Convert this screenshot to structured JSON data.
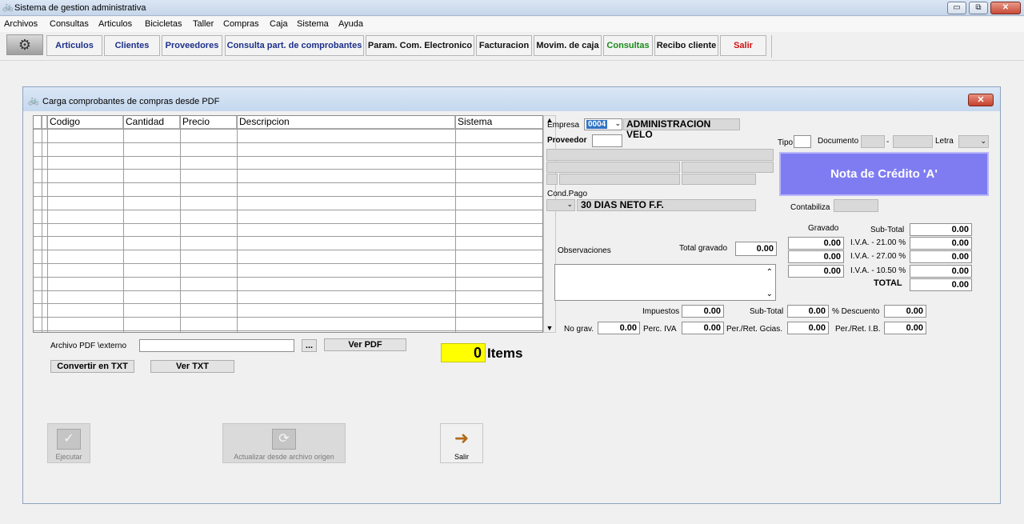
{
  "window": {
    "title": "Sistema de gestion administrativa",
    "min_btn": "▭",
    "max_btn": "⧉",
    "close_btn": "✕"
  },
  "menu": [
    "Archivos",
    "Consultas",
    "Articulos",
    "Bicicletas",
    "Taller",
    "Compras",
    "Caja",
    "Sistema",
    "Ayuda"
  ],
  "toolbar": {
    "logo_icon": "bicycle-chain-logo",
    "buttons": [
      "Articulos",
      "Clientes",
      "Proveedores",
      "Consulta part. de comprobantes",
      "Param. Com. Electronico",
      "Facturacion",
      "Movim. de caja",
      "Consultas",
      "Recibo cliente",
      "Salir"
    ]
  },
  "child": {
    "title": "Carga comprobantes de compras desde PDF",
    "close_btn": "✕",
    "grid": {
      "columns": [
        "Codigo",
        "Cantidad",
        "Precio",
        "Descripcion",
        "Sistema"
      ],
      "row_count": 15
    },
    "pdf_label": "Archivo PDF \\externo",
    "pdf_value": "",
    "browse_btn": "...",
    "ver_pdf_btn": "Ver PDF",
    "convertir_btn": "Convertir en TXT",
    "ver_txt_btn": "Ver TXT",
    "items_count": "0",
    "items_label": "Items",
    "ejecutar_btn": "Ejecutar",
    "actualizar_btn": "Actualizar desde archivo origen",
    "salir_btn": "Salir",
    "empresa_label": "Empresa",
    "empresa_code": "0004",
    "empresa_name": "ADMINISTRACION VELO",
    "proveedor_label": "Proveedor",
    "tipo_label": "Tipo",
    "documento_label": "Documento",
    "doc_sep": "-",
    "letra_label": "Letra",
    "doc_type": "Nota de Crédito 'A'",
    "cond_pago_label": "Cond.Pago",
    "cond_pago_value": "30 DIAS NETO F.F.",
    "contabiliza_label": "Contabiliza",
    "observaciones_label": "Observaciones",
    "total_gravado_label": "Total gravado",
    "total_gravado": "0.00",
    "gravado_label": "Gravado",
    "subtotal_label": "Sub-Total",
    "subtotal": "0.00",
    "gravado_rows": [
      {
        "gravado": "0.00",
        "label": "I.V.A. - 21.00 %",
        "value": "0.00"
      },
      {
        "gravado": "0.00",
        "label": "I.V.A. - 27.00 %",
        "value": "0.00"
      },
      {
        "gravado": "0.00",
        "label": "I.V.A. - 10.50 %",
        "value": "0.00"
      }
    ],
    "total_label": "TOTAL",
    "total": "0.00",
    "impuestos_label": "Impuestos",
    "impuestos": "0.00",
    "subtotal2_label": "Sub-Total",
    "subtotal2": "0.00",
    "descuento_label": "% Descuento",
    "descuento": "0.00",
    "no_grav_label": "No grav.",
    "no_grav": "0.00",
    "perc_iva_label": "Perc. IVA",
    "perc_iva": "0.00",
    "per_gcias_label": "Per./Ret. Gcias.",
    "per_gcias": "0.00",
    "per_ib_label": "Per./Ret. I.B.",
    "per_ib": "0.00"
  },
  "colors": {
    "doc_type_bg": "#7f7cf2",
    "items_bg": "#ffff00",
    "toolbar_text": "#1c2f8a"
  }
}
